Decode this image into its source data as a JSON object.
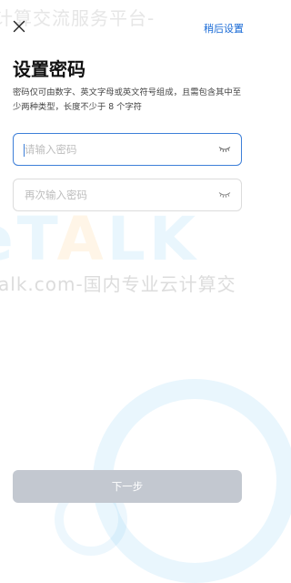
{
  "watermark": {
    "top_text": "计算交流服务平台-",
    "logo_text": "eTALK",
    "mid_text": "alk.com-国内专业云计算交"
  },
  "header": {
    "close_icon": "close-icon",
    "skip_label": "稍后设置"
  },
  "main": {
    "title": "设置密码",
    "description": "密码仅可由数字、英文字母或英文符号组成，且需包含其中至少两种类型，长度不少于 8 个字符",
    "password": {
      "value": "",
      "placeholder": "请输入密码",
      "toggle_icon": "eye-closed-icon"
    },
    "confirm_password": {
      "value": "",
      "placeholder": "再次输入密码",
      "toggle_icon": "eye-closed-icon"
    },
    "next_label": "下一步"
  },
  "colors": {
    "accent": "#1769d6",
    "focus_border": "#3e7fd8",
    "button_disabled": "#c3c8d0"
  }
}
